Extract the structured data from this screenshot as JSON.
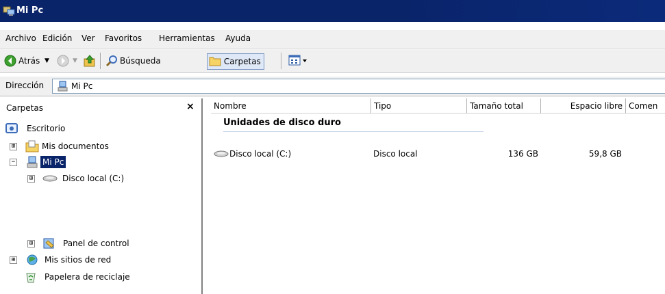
{
  "window": {
    "title": "Mi Pc"
  },
  "menu": [
    "Archivo",
    "Edición",
    "Ver",
    "Favoritos",
    "Herramientas",
    "Ayuda"
  ],
  "toolbar": {
    "back_label": "Atrás",
    "search_label": "Búsqueda",
    "folders_label": "Carpetas"
  },
  "address": {
    "label": "Dirección",
    "value": "Mi Pc"
  },
  "folders_pane": {
    "title": "Carpetas",
    "close": "×",
    "tree": {
      "desktop": "Escritorio",
      "my_documents": "Mis documentos",
      "my_pc": "Mi Pc",
      "local_disk": "Disco local (C:)",
      "control_panel": "Panel de control",
      "network": "Mis sitios de red",
      "recycle_bin": "Papelera de reciclaje"
    },
    "expander": "⊞"
  },
  "details": {
    "columns": [
      "Nombre",
      "Tipo",
      "Tamaño total",
      "Espacio libre",
      "Comen"
    ],
    "group": "Unidades de disco duro",
    "rows": [
      {
        "name": "Disco local (C:)",
        "type": "Disco local",
        "total": "136 GB",
        "free": "59,8 GB"
      }
    ]
  },
  "colors": {
    "titlebar": "#0a246a",
    "selection": "#0a246a",
    "chrome": "#f0f0f0"
  }
}
